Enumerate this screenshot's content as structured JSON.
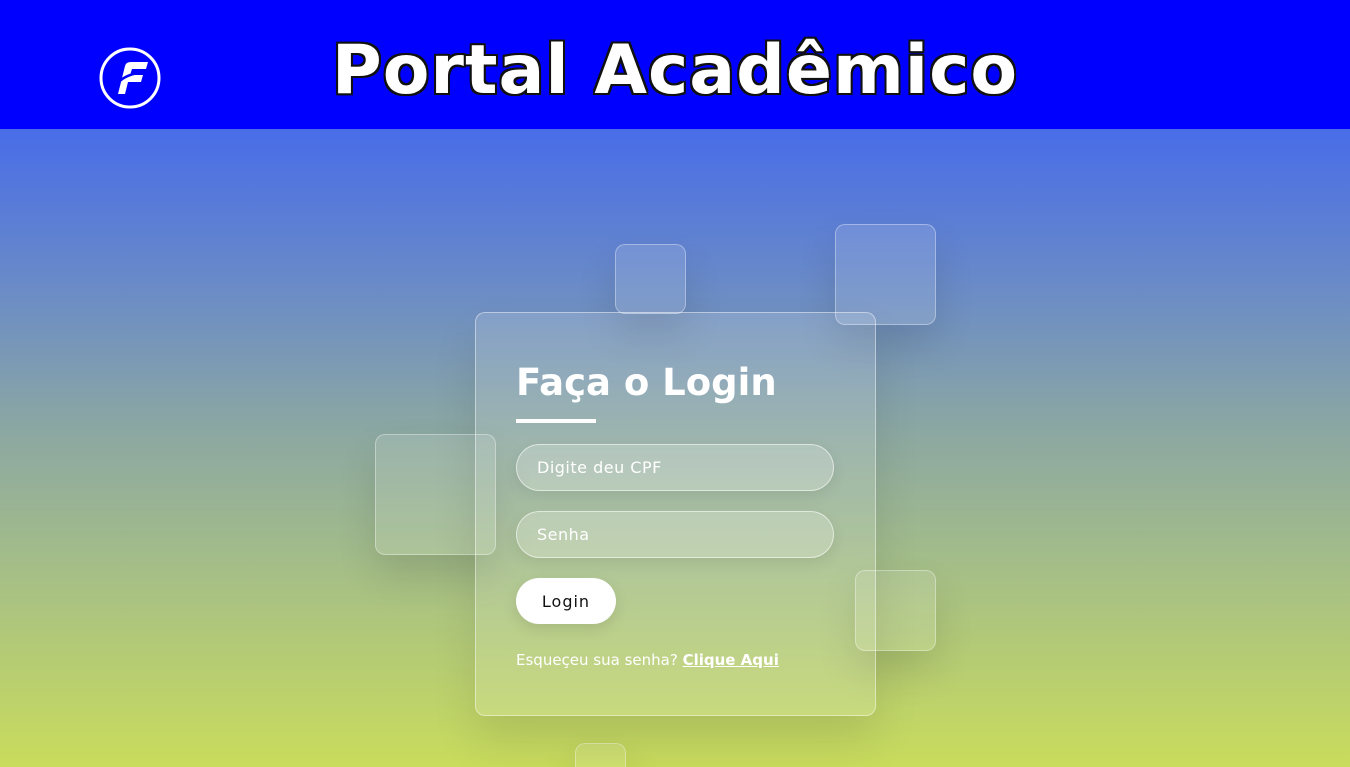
{
  "header": {
    "title": "Portal Acadêmico",
    "logo_icon": "portal-logo-f-icon",
    "background_color": "#0000ff"
  },
  "login": {
    "title": "Faça o Login",
    "cpf_placeholder": "Digite deu CPF",
    "password_placeholder": "Senha",
    "button_label": "Login",
    "forgot_text": "Esqueçeu sua senha?",
    "forgot_link": "Clique Aqui"
  },
  "colors": {
    "gradient_top": "#3a5ffc",
    "gradient_bottom": "#c9dc5c",
    "text": "#ffffff"
  }
}
